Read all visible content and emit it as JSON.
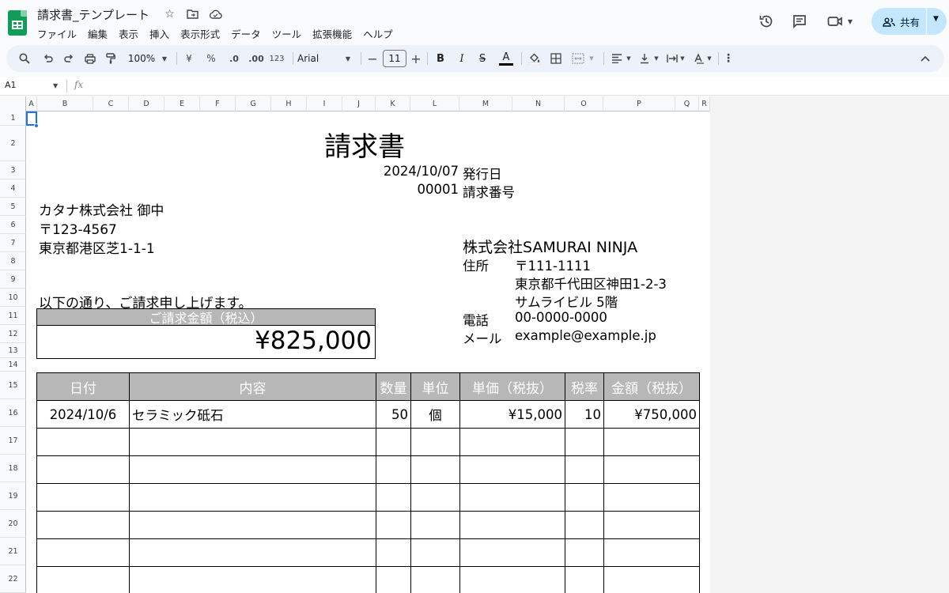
{
  "header": {
    "doc_title": "請求書_テンプレート",
    "menu": [
      "ファイル",
      "編集",
      "表示",
      "挿入",
      "表示形式",
      "データ",
      "ツール",
      "拡張機能",
      "ヘルプ"
    ],
    "share_label": "共有"
  },
  "toolbar": {
    "zoom": "100%",
    "currency": "¥",
    "percent": "%",
    "dec_decrease": ".0",
    "dec_increase": ".00",
    "number_format": "123",
    "font": "Arial",
    "font_size": "11",
    "bold": "B",
    "italic": "I",
    "strike": "S",
    "text_color": "A"
  },
  "formula_bar": {
    "cell_ref": "A1",
    "fx": "fx"
  },
  "columns": [
    "A",
    "B",
    "C",
    "D",
    "E",
    "F",
    "G",
    "H",
    "I",
    "J",
    "K",
    "L",
    "M",
    "N",
    "O",
    "P",
    "Q",
    "R"
  ],
  "rows": [
    "1",
    "2",
    "3",
    "4",
    "5",
    "6",
    "7",
    "8",
    "9",
    "10",
    "11",
    "12",
    "13",
    "14",
    "15",
    "16",
    "17",
    "18",
    "19",
    "20",
    "21",
    "22"
  ],
  "invoice": {
    "title": "請求書",
    "issue_date_label": "発行日",
    "issue_date": "2024/10/07",
    "invoice_no_label": "請求番号",
    "invoice_no": "00001",
    "client_name": "カタナ株式会社 御中",
    "client_zip": "〒123-4567",
    "client_address": "東京都港区芝1-1-1",
    "intro": "以下の通り、ご請求申し上げます。",
    "amount_label": "ご請求金額（税込）",
    "amount": "¥825,000",
    "company_name": "株式会社SAMURAI NINJA",
    "address_label": "住所",
    "company_zip": "〒111-1111",
    "company_address1": "東京都千代田区神田1-2-3",
    "company_address2": "サムライビル 5階",
    "phone_label": "電話",
    "phone": "00-0000-0000",
    "mail_label": "メール",
    "mail": "example@example.jp"
  },
  "items_table": {
    "headers": [
      "日付",
      "内容",
      "数量",
      "単位",
      "単価（税抜）",
      "税率",
      "金額（税抜）"
    ],
    "rows": [
      [
        "2024/10/6",
        "セラミック砥石",
        "50",
        "個",
        "¥15,000",
        "10",
        "¥750,000"
      ]
    ]
  }
}
